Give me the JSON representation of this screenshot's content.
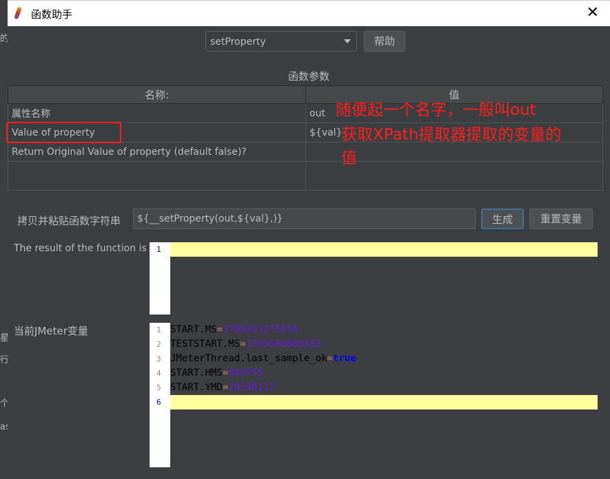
{
  "window": {
    "title": "函数助手",
    "close": "✕"
  },
  "parent_fragments": [
    "的",
    "星",
    "行",
    "个",
    "as"
  ],
  "function_select": {
    "value": "setProperty"
  },
  "help_button": "帮助",
  "params_section": "函数参数",
  "table": {
    "headers": [
      "名称:",
      "值"
    ],
    "rows": [
      [
        "属性名称",
        "out"
      ],
      [
        "Value of property",
        "${val}"
      ],
      [
        "Return Original Value of property (default false)?",
        ""
      ],
      [
        "",
        ""
      ]
    ]
  },
  "annotations": [
    "随便起一个名字，一般叫out",
    "获取XPath提取器提取的变量的",
    "值"
  ],
  "copy_label": "拷贝并粘贴函数字符串",
  "function_string": "${__setProperty(out,${val},)}",
  "generate_button": "生成",
  "reset_button": "重置变量",
  "result_label": "The result of the function is",
  "vars_label": "当前JMeter变量",
  "variables": [
    {
      "name": "START.MS",
      "value": "1705421275814"
    },
    {
      "name": "TESTSTART.MS",
      "value": "1705506885353"
    },
    {
      "name": "JMeterThread.last_sample_ok",
      "value": "true"
    },
    {
      "name": "START.HMS",
      "value": "000755"
    },
    {
      "name": "START.YMD",
      "value": "20240117"
    }
  ],
  "line_numbers": [
    "1",
    "2",
    "3",
    "4",
    "5",
    "6"
  ]
}
